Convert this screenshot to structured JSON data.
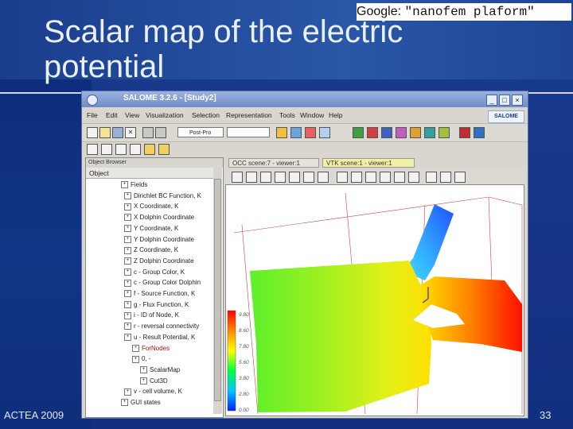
{
  "slide": {
    "title": "Scalar map of the electric potential",
    "footer_left": "ACTEA 2009",
    "page_number": "33"
  },
  "google_note": {
    "prefix": "Google: ",
    "query": "\"nanofem plaform\""
  },
  "window": {
    "title": "SALOME 3.2.6 - [Study2]",
    "menu": [
      "File",
      "Edit",
      "View",
      "Visualization",
      "Selection",
      "Representation",
      "Tools",
      "Window",
      "Help"
    ],
    "logo": "SALOME",
    "module_combo": "Post-Pro"
  },
  "browser": {
    "tab_label": "Object Browser",
    "header": "Object",
    "items": [
      {
        "label": "Fields",
        "indent": 0
      },
      {
        "label": "Dirichlet BC Function, K",
        "indent": 1
      },
      {
        "label": "X Coordinate, K",
        "indent": 1
      },
      {
        "label": "X Dolphin Coordinate",
        "indent": 1
      },
      {
        "label": "Y Coordinate, K",
        "indent": 1
      },
      {
        "label": "Y Dolphin Coordinate",
        "indent": 1
      },
      {
        "label": "Z Coordinate, K",
        "indent": 1
      },
      {
        "label": "Z Dolphin Coordinate",
        "indent": 1
      },
      {
        "label": "c - Group Color, K",
        "indent": 1
      },
      {
        "label": "c - Group Color Dolphin",
        "indent": 1
      },
      {
        "label": "f - Source Function, K",
        "indent": 1
      },
      {
        "label": "g - Flux Function, K",
        "indent": 1
      },
      {
        "label": "i - ID of Node, K",
        "indent": 1
      },
      {
        "label": "r - reversal connectivity",
        "indent": 1
      },
      {
        "label": "u - Result Potential, K",
        "indent": 1
      },
      {
        "label": "ForNodes",
        "indent": 2,
        "red": true
      },
      {
        "label": "0, -",
        "indent": 2
      },
      {
        "label": "ScalarMap",
        "indent": 3
      },
      {
        "label": "Cut3D",
        "indent": 3
      },
      {
        "label": "v - cell volume, K",
        "indent": 1
      },
      {
        "label": "GUI states",
        "indent": 0
      }
    ]
  },
  "viewer": {
    "tabs": [
      "OCC scene:7 - viewer:1",
      "VTK scene:1 - viewer:1"
    ],
    "active_tab": 1,
    "colorbar_labels": [
      "9.80",
      "8.60",
      "7.80",
      "5.60",
      "3.80",
      "2.80",
      "0.00"
    ]
  }
}
